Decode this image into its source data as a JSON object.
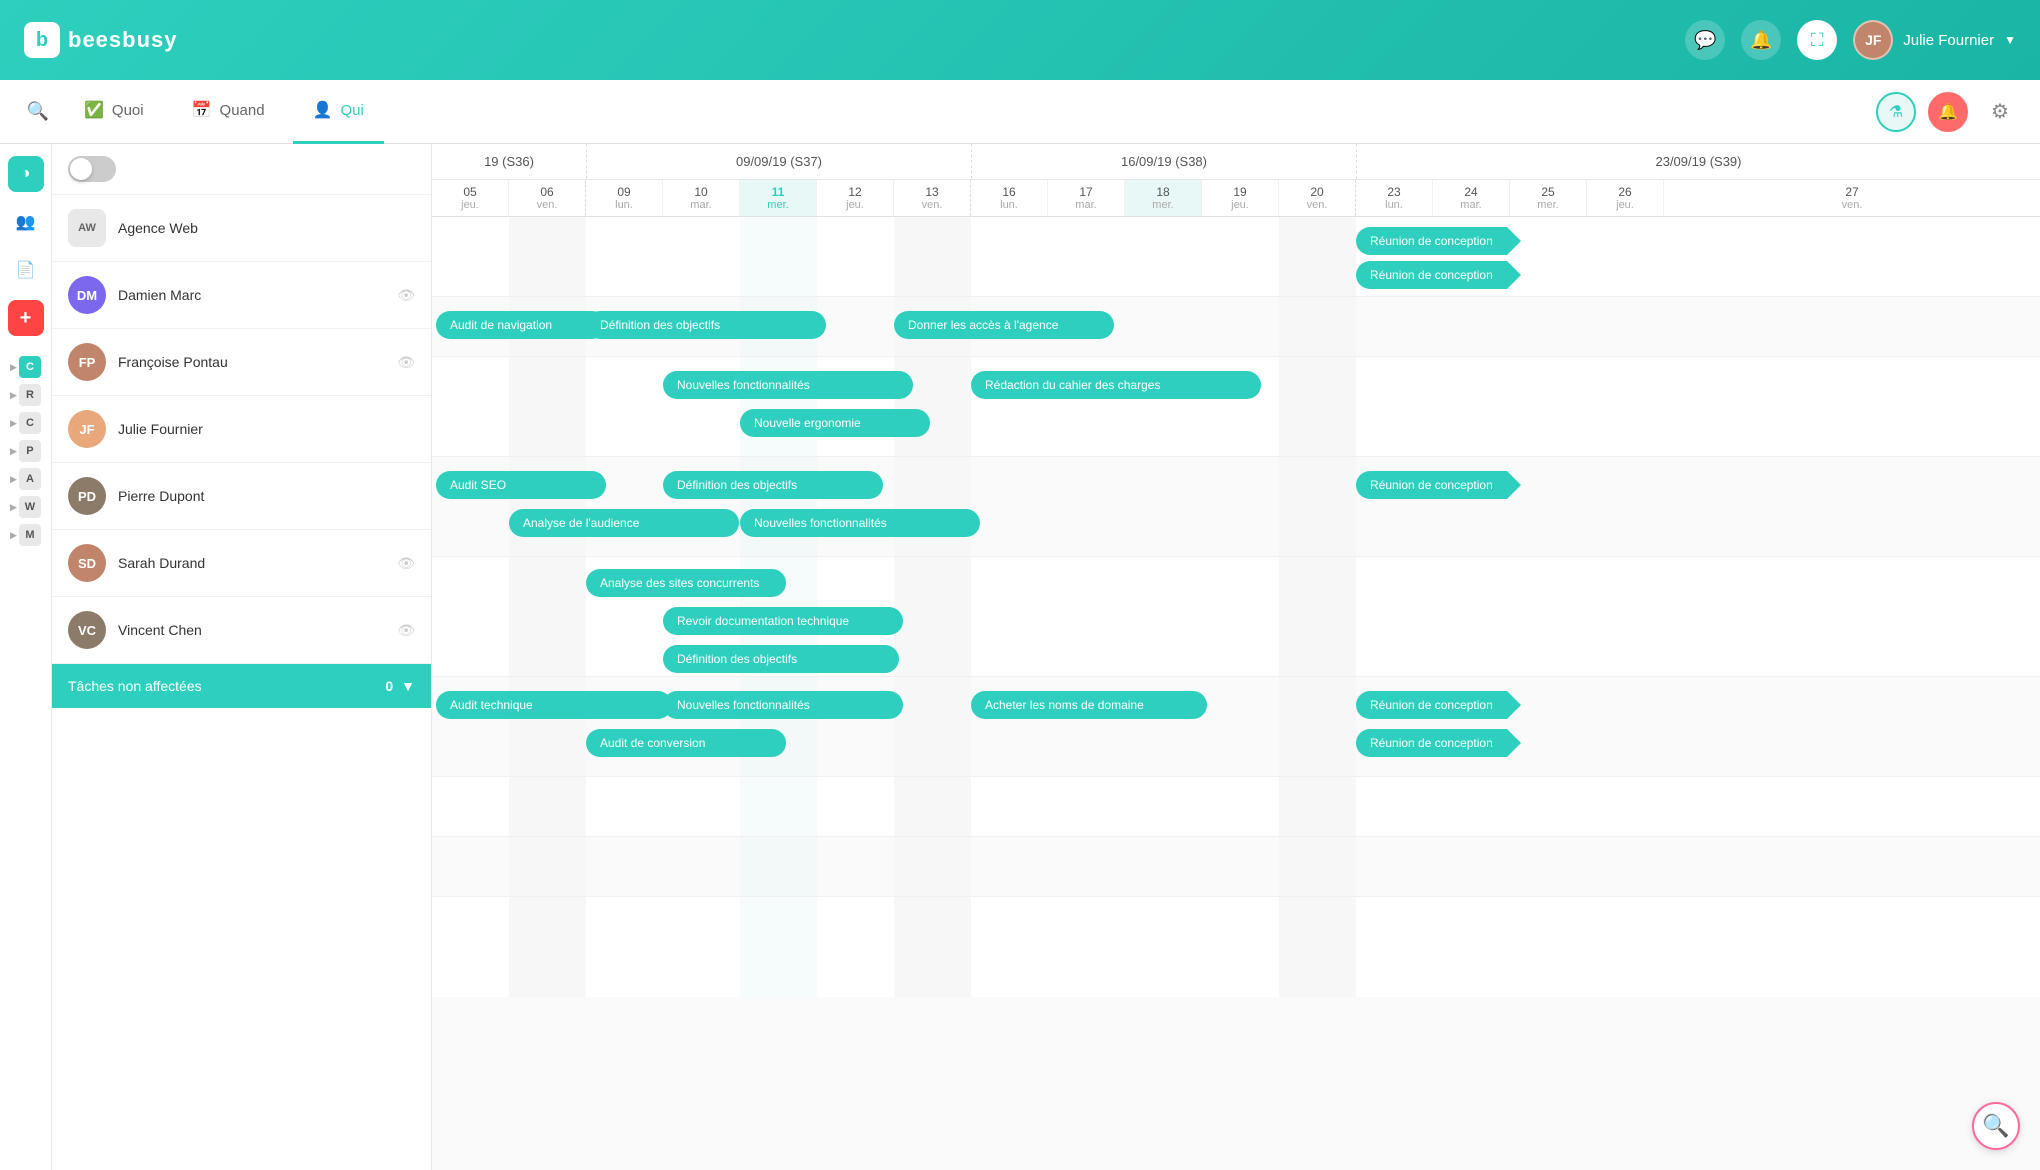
{
  "app": {
    "logo_text": "beesbusy",
    "logo_letter": "b"
  },
  "nav": {
    "user_name": "Julie Fournier",
    "user_initials": "JF"
  },
  "tabs": {
    "search_icon": "🔍",
    "items": [
      {
        "label": "Quoi",
        "icon": "✅",
        "active": false
      },
      {
        "label": "Quand",
        "icon": "📅",
        "active": false
      },
      {
        "label": "Qui",
        "icon": "👤",
        "active": true
      }
    ]
  },
  "people": [
    {
      "type": "company",
      "name": "Agence Web",
      "initials": "AW",
      "color": "#e0e0e0",
      "text_color": "#555"
    },
    {
      "type": "person",
      "name": "Damien Marc",
      "initials": "DM",
      "color": "#7b68ee",
      "has_eye": true
    },
    {
      "type": "person",
      "name": "Françoise Pontau",
      "initials": "FP",
      "color": "#c0856a",
      "has_eye": true
    },
    {
      "type": "person",
      "name": "Julie Fournier",
      "initials": "JF",
      "color": "#e8a87c",
      "has_eye": false
    },
    {
      "type": "person",
      "name": "Pierre Dupont",
      "initials": "PD",
      "color": "#8d7b6a",
      "has_eye": false
    },
    {
      "type": "person",
      "name": "Sarah Durand",
      "initials": "SD",
      "color": "#c0856a",
      "has_eye": true
    },
    {
      "type": "person",
      "name": "Vincent Chen",
      "initials": "VC",
      "color": "#8d7b6a",
      "has_eye": true
    }
  ],
  "unassigned": {
    "label": "Tâches non affectées",
    "count": "0"
  },
  "weeks": [
    {
      "label": "19 (S36)",
      "days": 2
    },
    {
      "label": "09/09/19 (S37)",
      "days": 5
    },
    {
      "label": "16/09/19 (S38)",
      "days": 5
    },
    {
      "label": "23/09/19 (S39)",
      "days": 5
    }
  ],
  "days": [
    {
      "num": "05",
      "label": "jeu."
    },
    {
      "num": "06",
      "label": "ven."
    },
    {
      "num": "09",
      "label": "lun."
    },
    {
      "num": "10",
      "label": "mar."
    },
    {
      "num": "11",
      "label": "mer."
    },
    {
      "num": "12",
      "label": "jeu."
    },
    {
      "num": "13",
      "label": "ven."
    },
    {
      "num": "16",
      "label": "lun."
    },
    {
      "num": "17",
      "label": "mar."
    },
    {
      "num": "18",
      "label": "mer."
    },
    {
      "num": "19",
      "label": "jeu."
    },
    {
      "num": "20",
      "label": "ven."
    },
    {
      "num": "23",
      "label": "lun."
    },
    {
      "num": "24",
      "label": "mar."
    },
    {
      "num": "25",
      "label": "mer."
    },
    {
      "num": "26",
      "label": "jeu."
    },
    {
      "num": "27",
      "label": "ven."
    }
  ],
  "tasks": {
    "agence_web_row1": [
      {
        "label": "Réunion de conception",
        "col_start": 13,
        "col_span": 3,
        "type": "arrow"
      },
      {
        "label": "Réunion de conception",
        "col_start": 13,
        "col_span": 3,
        "type": "arrow",
        "row": 2
      }
    ],
    "agence_web": [
      {
        "label": "Audit de navigation",
        "col_start": 1,
        "col_span": 3
      },
      {
        "label": "Définition des objectifs",
        "col_start": 3,
        "col_span": 4
      },
      {
        "label": "Donner les accès à l'agence",
        "col_start": 7,
        "col_span": 3
      },
      {
        "label": "Réunion de conception",
        "col_start": 13,
        "col_span": 4,
        "arrow": true
      }
    ]
  },
  "sidebar_icons": [
    {
      "name": "pie-chart",
      "symbol": "◑",
      "active": true
    },
    {
      "name": "people",
      "symbol": "👥",
      "active": false
    },
    {
      "name": "document",
      "symbol": "📄",
      "active": false
    },
    {
      "name": "plus",
      "symbol": "+",
      "active": false,
      "red": true
    }
  ]
}
